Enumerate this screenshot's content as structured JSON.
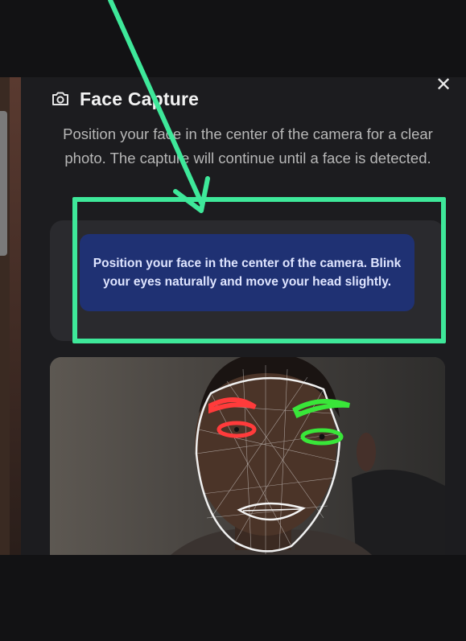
{
  "modal": {
    "title": "Face Capture",
    "title_icon": "camera-icon",
    "close_icon": "close-icon",
    "close_glyph": "✕",
    "description": "Position your face in the center of the camera for a clear photo. The capture will continue until a face is detected.",
    "instruction": "Position your face in the center of the camera. Blink your eyes naturally and move your head slightly."
  },
  "colors": {
    "annotation": "#3ee89a",
    "banner": "#1f3173",
    "left_eye_marker": "#ff3b3b",
    "right_eye_marker": "#39e639"
  }
}
